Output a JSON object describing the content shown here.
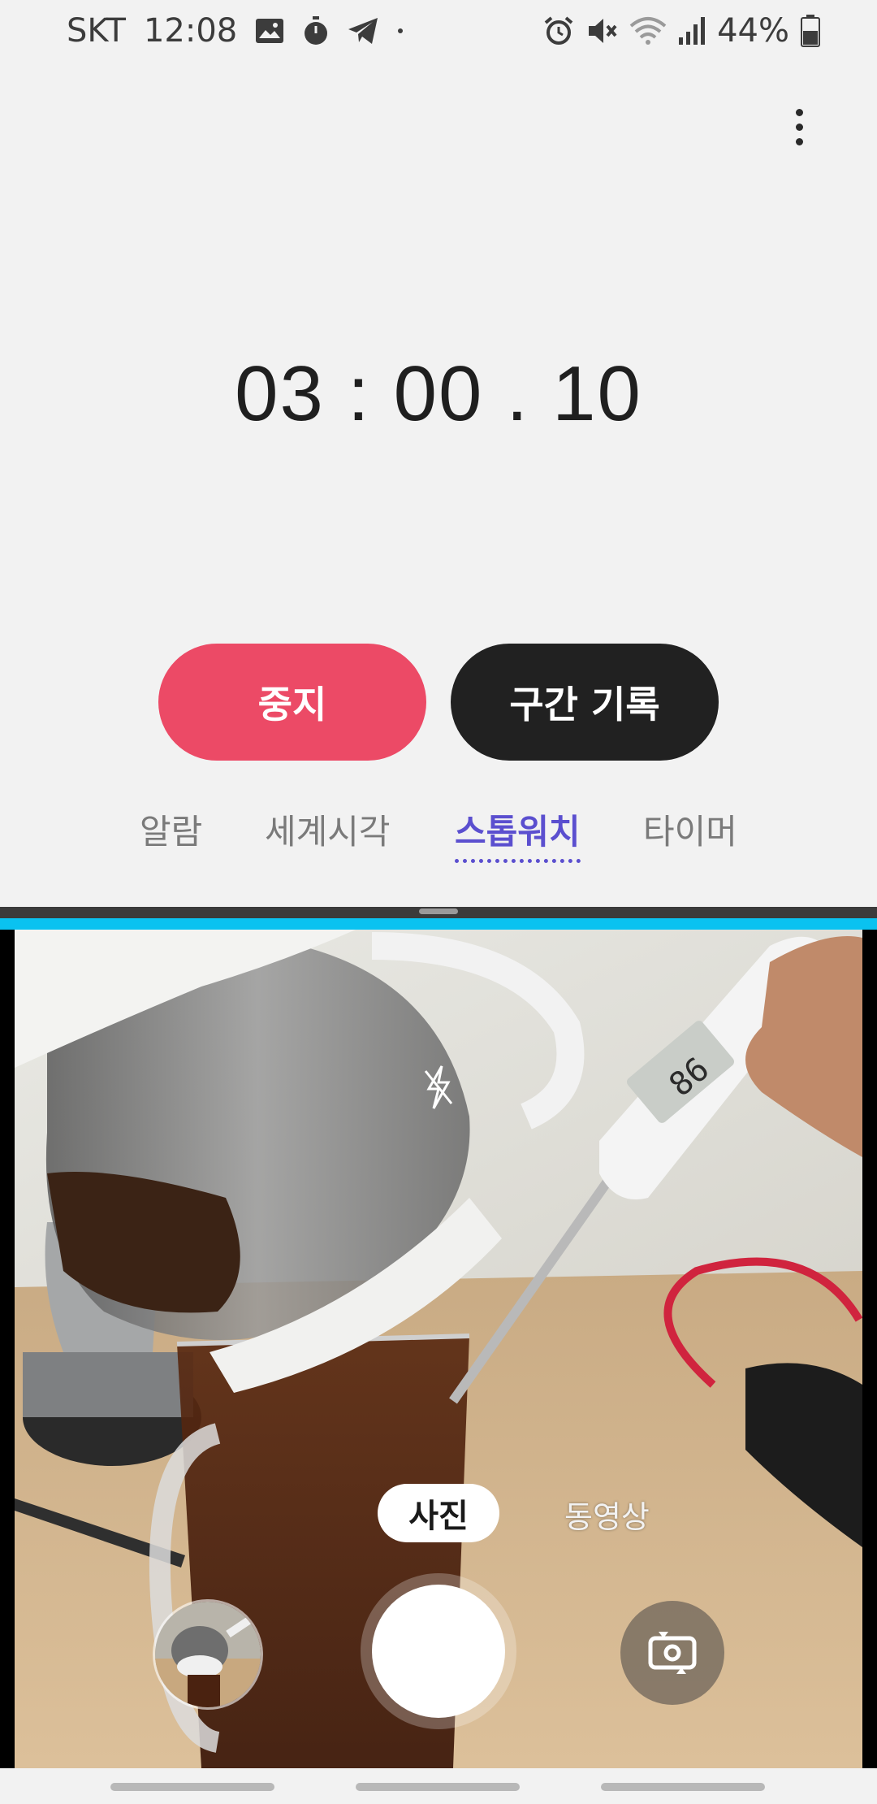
{
  "status_bar": {
    "carrier": "SKT",
    "time": "12:08",
    "battery": "44%",
    "left_icons": [
      "gallery-icon",
      "stopwatch-icon",
      "telegram-icon",
      "dot-icon"
    ],
    "right_icons": [
      "alarm-icon",
      "mute-icon",
      "wifi-icon",
      "signal-icon",
      "battery-icon"
    ]
  },
  "stopwatch": {
    "minutes": "03",
    "seconds": "00",
    "hundredths": "10",
    "sep1": ":",
    "sep2": "."
  },
  "buttons": {
    "stop_label": "중지",
    "lap_label": "구간 기록"
  },
  "tabs": [
    {
      "label": "알람",
      "active": false
    },
    {
      "label": "세계시각",
      "active": false
    },
    {
      "label": "스톱워치",
      "active": true
    },
    {
      "label": "타이머",
      "active": false
    }
  ],
  "camera": {
    "modes": {
      "photo": "사진",
      "video": "동영상"
    },
    "selected_mode": "사진",
    "icons": {
      "switch": "switch-camera-icon",
      "flash": "flash-off-icon",
      "more": "more-vert-icon"
    }
  },
  "colors": {
    "stop_button": "#ec4a66",
    "lap_button": "#212121",
    "active_tab": "#5b4fcf",
    "divider": "#0ac2f0"
  }
}
